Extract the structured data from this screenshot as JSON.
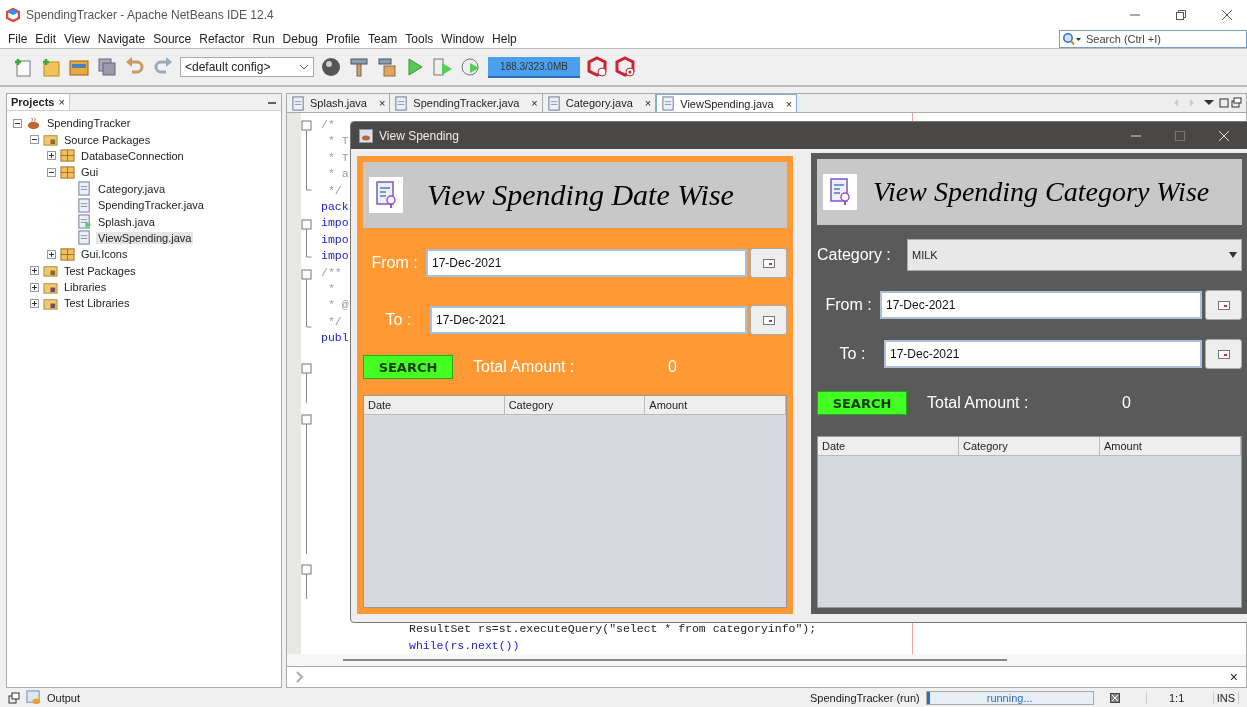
{
  "window": {
    "title": "SpendingTracker - Apache NetBeans IDE 12.4"
  },
  "menu": [
    "File",
    "Edit",
    "View",
    "Navigate",
    "Source",
    "Refactor",
    "Run",
    "Debug",
    "Profile",
    "Team",
    "Tools",
    "Window",
    "Help"
  ],
  "search": {
    "placeholder": "Search (Ctrl +I)"
  },
  "toolbar": {
    "config": "<default config>",
    "memory": "188.3/323.0MB"
  },
  "projects": {
    "title": "Projects",
    "close": "×",
    "tree": [
      {
        "label": "SpendingTracker",
        "kind": "project",
        "expanded": true,
        "selected": false,
        "children": [
          {
            "label": "Source Packages",
            "kind": "folder",
            "expanded": true,
            "selected": false,
            "children": [
              {
                "label": "DatabaseConnection",
                "kind": "package",
                "expanded": false,
                "selected": false
              },
              {
                "label": "Gui",
                "kind": "package",
                "expanded": true,
                "selected": false,
                "children": [
                  {
                    "label": "Category.java",
                    "kind": "java",
                    "selected": false
                  },
                  {
                    "label": "SpendingTracker.java",
                    "kind": "java",
                    "selected": false
                  },
                  {
                    "label": "Splash.java",
                    "kind": "main",
                    "selected": false
                  },
                  {
                    "label": "ViewSpending.java",
                    "kind": "java",
                    "selected": true
                  }
                ]
              },
              {
                "label": "Gui.Icons",
                "kind": "package",
                "expanded": false,
                "selected": false
              }
            ]
          },
          {
            "label": "Test Packages",
            "kind": "folder",
            "expanded": false,
            "selected": false
          },
          {
            "label": "Libraries",
            "kind": "library",
            "expanded": false,
            "selected": false
          },
          {
            "label": "Test Libraries",
            "kind": "library",
            "expanded": false,
            "selected": false
          }
        ]
      }
    ]
  },
  "editor": {
    "tabs": [
      {
        "label": "Splash.java",
        "close": "×",
        "selected": false
      },
      {
        "label": "SpendingTracker.java",
        "close": "×",
        "selected": false
      },
      {
        "label": "Category.java",
        "close": "×",
        "selected": false
      },
      {
        "label": "ViewSpending.java",
        "close": "×",
        "selected": true
      }
    ],
    "lines": [
      {
        "text": "/*",
        "kind": "comment"
      },
      {
        "text": " * T",
        "kind": "comment"
      },
      {
        "text": " * T",
        "kind": "comment"
      },
      {
        "text": " * a",
        "kind": "comment"
      },
      {
        "text": " */",
        "kind": "comment"
      },
      {
        "text": "pack",
        "kind": "keyword"
      },
      {
        "text": "impo",
        "kind": "keyword"
      },
      {
        "text": "impo",
        "kind": "keyword"
      },
      {
        "text": "impo",
        "kind": "keyword"
      },
      {
        "text": "/**",
        "kind": "comment"
      },
      {
        "text": " *",
        "kind": "comment"
      },
      {
        "text": " * @",
        "kind": "comment"
      },
      {
        "text": " */",
        "kind": "comment"
      },
      {
        "text": "publ",
        "kind": "keyword"
      }
    ],
    "bottom_lines": [
      {
        "text": "ResultSet rs=st.executeQuery(\"select * from categoryinfo\");",
        "kind": "plain"
      },
      {
        "text": "while(rs.next())",
        "kind": "keyword"
      }
    ]
  },
  "dialog": {
    "title": "View Spending",
    "date_panel": {
      "heading": "View Spending Date Wise",
      "from_label": "From :",
      "from_value": "17-Dec-2021",
      "to_label": "To :",
      "to_value": "17-Dec-2021",
      "search_button": "SEARCH",
      "total_label": "Total Amount :",
      "total_value": "0",
      "columns": [
        "Date",
        "Category",
        "Amount"
      ]
    },
    "category_panel": {
      "heading": "View Spending Category Wise",
      "category_label": "Category :",
      "category_value": "MILK",
      "from_label": "From :",
      "from_value": "17-Dec-2021",
      "to_label": "To :",
      "to_value": "17-Dec-2021",
      "search_button": "SEARCH",
      "total_label": "Total Amount :",
      "total_value": "0",
      "columns": [
        "Date",
        "Category",
        "Amount"
      ]
    }
  },
  "output": {
    "close": "×",
    "label": "Output"
  },
  "status_bar": {
    "process": "SpendingTracker (run)",
    "progress": {
      "text": "running...",
      "level": 0.02
    },
    "position": "1:1",
    "mode": "INS"
  }
}
